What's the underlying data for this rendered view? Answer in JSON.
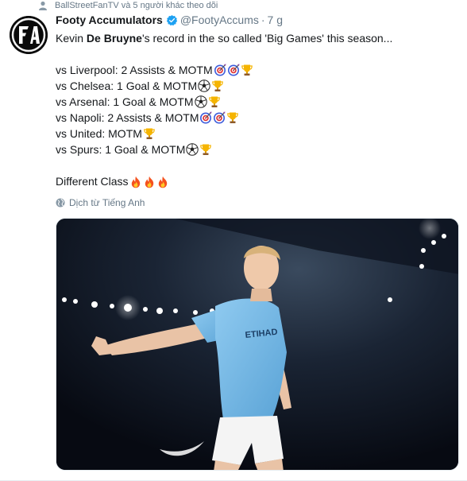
{
  "social_context": {
    "text": "BallStreetFanTV và 5 người khác theo dõi",
    "icon": "person-icon"
  },
  "author": {
    "name": "Footy Accumulators",
    "handle": "@FootyAccums",
    "separator": "·",
    "time": "7 g",
    "verified": true,
    "avatar_letters": "FA"
  },
  "tweet": {
    "intro_prefix": "Kevin ",
    "intro_name": "De Bruyne",
    "intro_suffix": "'s record in the so called 'Big Games' this season...",
    "lines": [
      {
        "text": "vs Liverpool: 2 Assists & MOTM",
        "emojis": [
          "target",
          "target",
          "trophy"
        ]
      },
      {
        "text": "vs Chelsea: 1 Goal & MOTM",
        "emojis": [
          "soccer-ball",
          "trophy"
        ]
      },
      {
        "text": "vs Arsenal: 1 Goal & MOTM",
        "emojis": [
          "soccer-ball",
          "trophy"
        ]
      },
      {
        "text": "vs Napoli: 2 Assists & MOTM",
        "emojis": [
          "target",
          "target",
          "trophy"
        ]
      },
      {
        "text": "vs United: MOTM",
        "emojis": [
          "trophy"
        ]
      },
      {
        "text": "vs Spurs: 1 Goal & MOTM",
        "emojis": [
          "soccer-ball",
          "trophy"
        ]
      }
    ],
    "closing": "Different Class",
    "closing_emojis": [
      "fire",
      "fire",
      "fire"
    ]
  },
  "translate_label": "Dịch từ Tiếng Anh",
  "photo": {
    "jersey_sponsor": "ETIHAD",
    "jersey_brand": "nike",
    "colors": {
      "sky": "#6fb6e6",
      "shorts": "#f4f4f4",
      "background": "#0c1220"
    }
  },
  "colors": {
    "text": "#14171a",
    "secondary": "#657786",
    "verified": "#1da1f2",
    "border": "#e6ecf0"
  }
}
